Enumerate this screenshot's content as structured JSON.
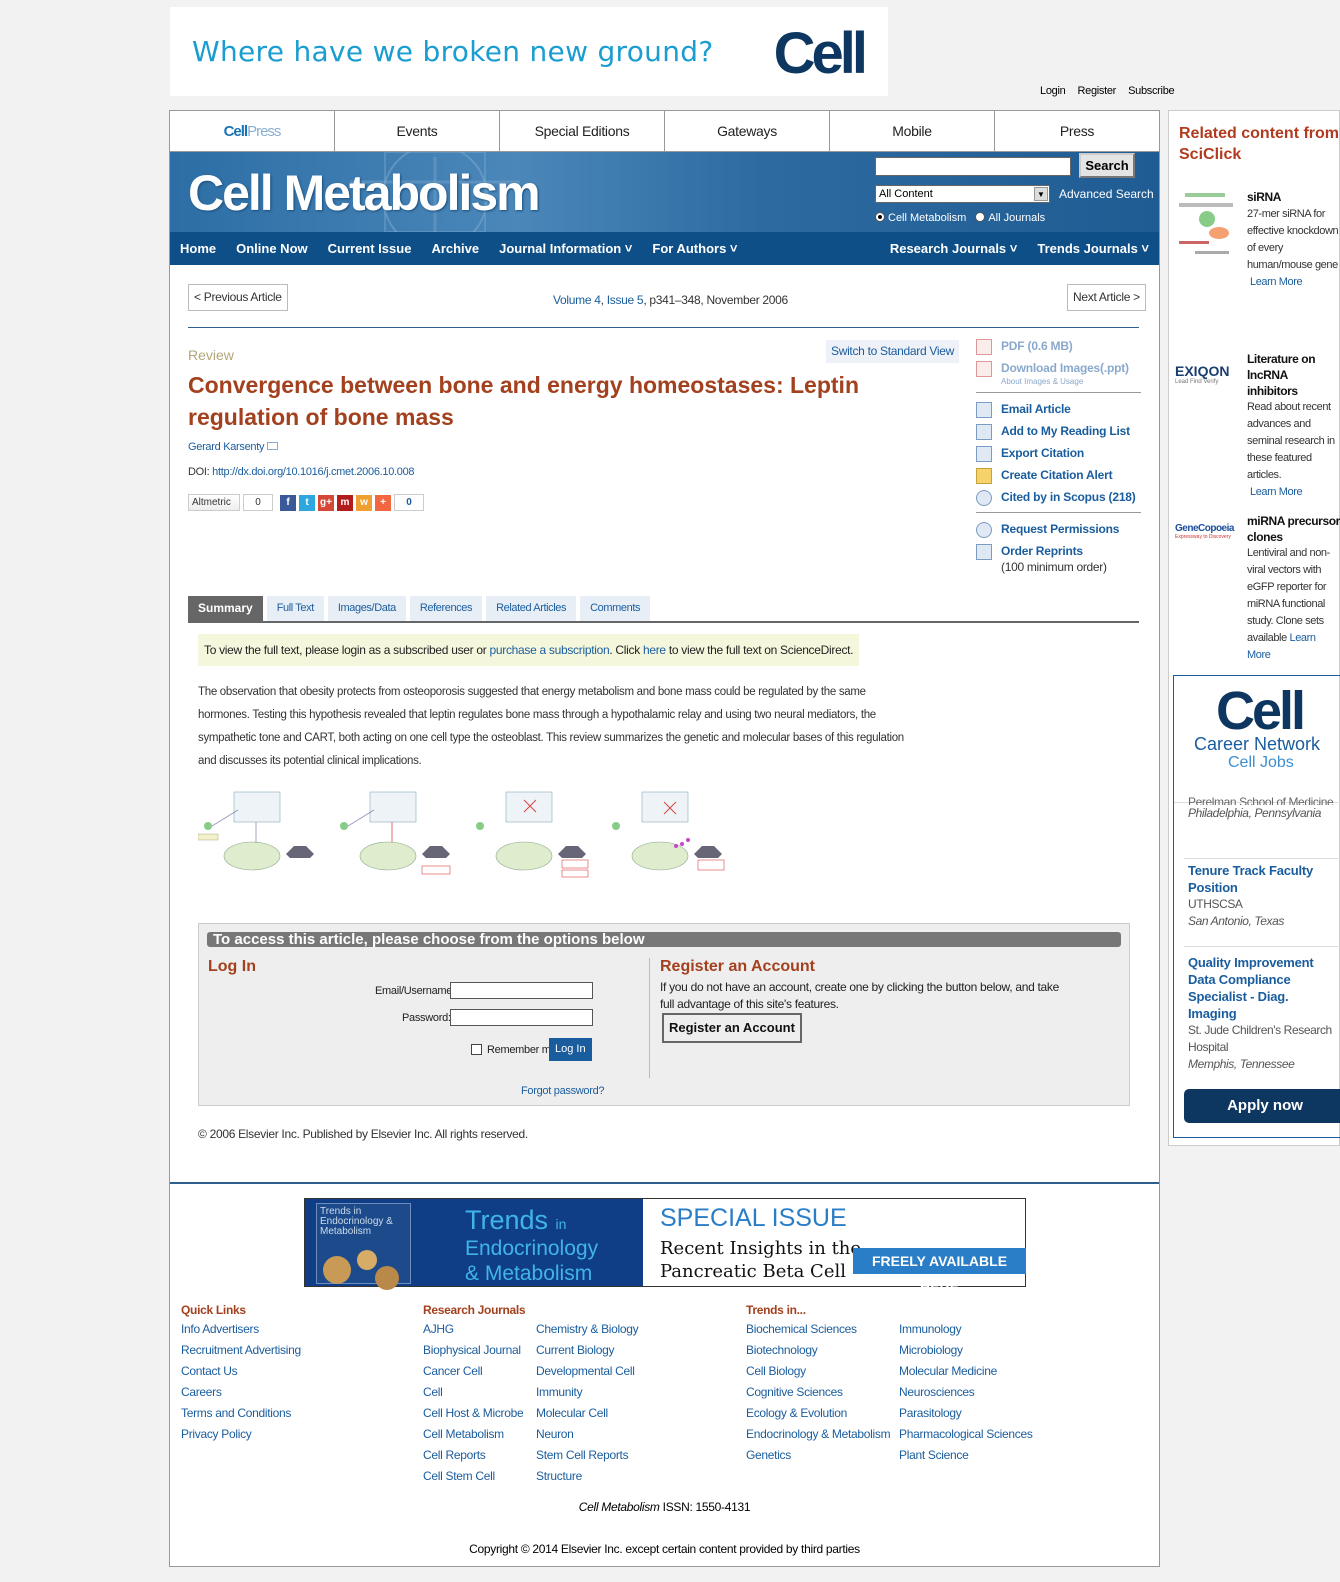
{
  "banner": {
    "tagline": "Where have we broken new ground?",
    "logo": "Cell"
  },
  "toplinks": [
    "Login",
    "Register",
    "Subscribe"
  ],
  "nav1": [
    "Events",
    "Special Editions",
    "Gateways",
    "Mobile",
    "Press"
  ],
  "nav1_brand": {
    "a": "Cell",
    "b": "Press"
  },
  "masthead": {
    "title": "Cell Metabolism",
    "search_button": "Search",
    "scope_select": "All Content",
    "advanced_search": "Advanced Search",
    "radio1": "Cell Metabolism",
    "radio2": "All Journals"
  },
  "nav2": {
    "left": [
      "Home",
      "Online Now",
      "Current Issue",
      "Archive",
      "Journal Information ˅",
      "For Authors ˅"
    ],
    "right": [
      "Research Journals ˅",
      "Trends Journals ˅"
    ]
  },
  "pager": {
    "prev": "< Previous Article",
    "next": "Next Article >",
    "volume": "Volume 4",
    "issue": "Issue 5",
    "rest": ", p341–348, November 2006"
  },
  "article": {
    "type": "Review",
    "switch": "Switch to Standard View",
    "title": "Convergence between bone and energy homeostases: Leptin regulation of bone mass",
    "author": "Gerard Karsenty",
    "doi_label": "DOI: ",
    "doi": "http://dx.doi.org/10.1016/j.cmet.2006.10.008",
    "altmetric": "Altmetric",
    "altmetric_count": "0",
    "share_count": "0"
  },
  "sidebar": {
    "pdf": "PDF (0.6 MB)",
    "download": "Download Images(.ppt)",
    "about": "About Images & Usage",
    "email": "Email Article",
    "reading": "Add to My Reading List",
    "export": "Export Citation",
    "alert": "Create Citation Alert",
    "cited": "Cited by in Scopus (218)",
    "perm": "Request Permissions",
    "reprints": "Order Reprints",
    "reprints_note": "(100 minimum order)"
  },
  "tabs": [
    "Summary",
    "Full Text",
    "Images/Data",
    "References",
    "Related Articles",
    "Comments"
  ],
  "notice": {
    "a": "To view the full text, please login as a subscribed user or ",
    "link1": "purchase a subscription",
    "b": ". Click ",
    "link2": "here",
    "c": " to view the full text on ScienceDirect."
  },
  "abstract": "The observation that obesity protects from osteoporosis suggested that energy metabolism and bone mass could be regulated by the same hormones. Testing this hypothesis revealed that leptin regulates bone mass through a hypothalamic relay and using two neural mediators, the sympathetic tone and CART, both acting on one cell type the osteoblast. This review summarizes the genetic and molecular bases of this regulation and discusses its potential clinical implications.",
  "access": {
    "header": "To access this article, please choose from the options below",
    "login_title": "Log In",
    "email_label": "Email/Username:",
    "password_label": "Password:",
    "remember": "Remember me",
    "login_btn": "Log In",
    "forgot": "Forgot password?",
    "register_title": "Register an Account",
    "register_text": "If you do not have an account, create one by clicking the button below, and take full advantage of this site's features.",
    "register_btn": "Register an Account"
  },
  "copyright1": "© 2006 Elsevier Inc. Published by Elsevier Inc. All rights reserved.",
  "ad2": {
    "trends": "Trends",
    "in": "in",
    "endo": "Endocrinology",
    "metab": "& Metabolism",
    "special": "SPECIAL ISSUE",
    "recent1": "Recent Insights in the",
    "recent2": "Pancreatic Beta Cell",
    "free": "FREELY AVAILABLE HERE",
    "cover_title": "Trends in Endocrinology & Metabolism"
  },
  "footer": {
    "quick_title": "Quick Links",
    "quick": [
      "Info Advertisers",
      "Recruitment Advertising",
      "Contact Us",
      "Careers",
      "Terms and Conditions",
      "Privacy Policy"
    ],
    "research_title": "Research Journals",
    "research1": [
      "AJHG",
      "Biophysical Journal",
      "Cancer Cell",
      "Cell",
      "Cell Host & Microbe",
      "Cell Metabolism",
      "Cell Reports",
      "Cell Stem Cell"
    ],
    "research2": [
      "Chemistry & Biology",
      "Current Biology",
      "Developmental Cell",
      "Immunity",
      "Molecular Cell",
      "Neuron",
      "Stem Cell Reports",
      "Structure"
    ],
    "trends_title": "Trends in...",
    "trends1": [
      "Biochemical Sciences",
      "Biotechnology",
      "Cell Biology",
      "Cognitive Sciences",
      "Ecology & Evolution",
      "Endocrinology & Metabolism",
      "Genetics"
    ],
    "trends2": [
      "Immunology",
      "Microbiology",
      "Molecular Medicine",
      "Neurosciences",
      "Parasitology",
      "Pharmacological Sciences",
      "Plant Science"
    ],
    "issn_journal": "Cell Metabolism",
    "issn": " ISSN: 1550-4131",
    "copyright": "Copyright © 2014 Elsevier Inc. except certain content provided by third parties"
  },
  "related": {
    "title1": "Related content from",
    "title2": "SciClick",
    "items": [
      {
        "title": "siRNA",
        "text": "27-mer siRNA for effective knockdown of every human/mouse gene",
        "link": "Learn More"
      },
      {
        "title": "Literature on lncRNA inhibitors",
        "text": "Read about recent advances and seminal research in these featured articles.",
        "link": "Learn More",
        "logo": "EXIQON",
        "logo_sub": "Lead Find Verify"
      },
      {
        "title": "miRNA precursor clones",
        "text": "Lentiviral and non-viral vectors with eGFP reporter for miRNA functional study. Clone sets available",
        "link": "Learn More",
        "logo": "GeneCopoeia",
        "logo_sub": "Expressway to Discovery"
      }
    ]
  },
  "career": {
    "logo": "Cell",
    "network": "Career Network",
    "jobs": "Cell Jobs",
    "partial": "Perelman School of Medicine",
    "list": [
      {
        "org": "",
        "loc": "Philadelphia, Pennsylvania",
        "title": ""
      },
      {
        "title": "Tenure Track Faculty Position",
        "org": "UTHSCSA",
        "loc": "San Antonio, Texas"
      },
      {
        "title": "Quality Improvement Data Compliance Specialist - Diag. Imaging",
        "org": "St. Jude Children's Research Hospital",
        "loc": "Memphis, Tennessee"
      }
    ],
    "apply": "Apply now"
  },
  "colors": {
    "brand_blue": "#0e4f88",
    "title_red": "#a3401e",
    "link": "#1a5d9e"
  }
}
